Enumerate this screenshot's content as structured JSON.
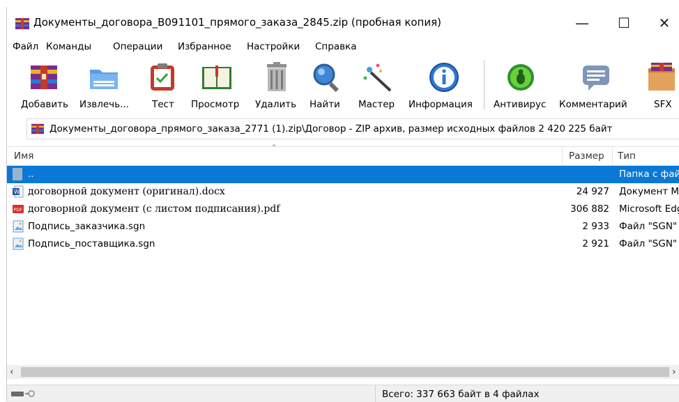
{
  "window": {
    "title": "Документы_договора_B091101_прямого_заказа_2845.zip (пробная копия)"
  },
  "menu": [
    "Файл",
    "Команды",
    "Операции",
    "Избранное",
    "Настройки",
    "Справка"
  ],
  "toolbar": {
    "add": "Добавить",
    "extract": "Извлечь...",
    "test": "Тест",
    "view": "Просмотр",
    "delete": "Удалить",
    "find": "Найти",
    "wizard": "Мастер",
    "info": "Информация",
    "antivirus": "Антивирус",
    "comment": "Комментарий",
    "sfx": "SFX"
  },
  "address": {
    "path": "Документы_договора_прямого_заказа_2771 (1).zip\\Договор - ZIP архив, размер исходных файлов 2 420 225 байт"
  },
  "columns": {
    "name": "Имя",
    "size": "Размер",
    "type": "Тип"
  },
  "files": [
    {
      "name": "..",
      "size": "",
      "type": "Папка с файлами",
      "icon": "folder-up-icon",
      "selected": true
    },
    {
      "name": "договорной документ (оригинал).docx",
      "size": "24 927",
      "type": "Документ Microsoft Word",
      "icon": "word-doc-icon"
    },
    {
      "name": "договорной документ (с листом подписания).pdf",
      "size": "306 882",
      "type": "Microsoft Edge PDF Document",
      "icon": "pdf-icon"
    },
    {
      "name": "Подпись_заказчика.sgn",
      "size": "2 933",
      "type": "Файл \"SGN\"",
      "icon": "image-file-icon"
    },
    {
      "name": "Подпись_поставщика.sgn",
      "size": "2 921",
      "type": "Файл \"SGN\"",
      "icon": "image-file-icon"
    }
  ],
  "status": {
    "summary": "Всего: 337 663 байт в 4 файлах"
  },
  "colors": {
    "selection": "#0a78d7",
    "status_bg": "#f0f0f0"
  }
}
